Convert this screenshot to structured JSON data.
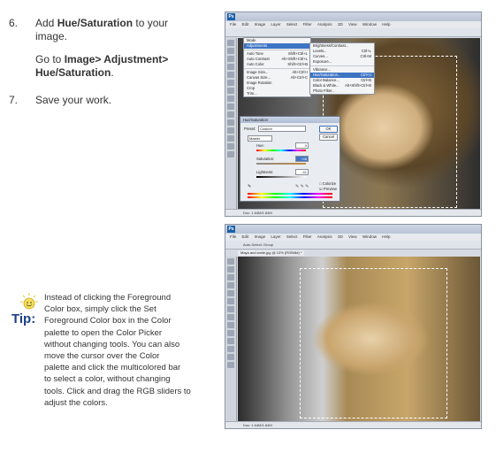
{
  "steps": [
    {
      "num": "6.",
      "pre": "Add ",
      "bold": "Hue/Saturation",
      "post": " to your image."
    },
    {
      "num": "",
      "pre": "Go to ",
      "bold": "Image> Adjustment> Hue/Saturation",
      "post": "."
    },
    {
      "num": "7.",
      "pre": "Save your work.",
      "bold": "",
      "post": ""
    }
  ],
  "tip": {
    "label": "Tip:",
    "lines": [
      "Instead of clicking the Foreground",
      "Color box, simply click the Set",
      "Foreground Color box in the Color",
      "palette to open the Color Picker",
      "without changing tools. You can also",
      "move the cursor over the Color",
      "palette and click  the multicolored bar",
      "to select a color, without changing",
      "tools. Click and drag the RGB sliders to",
      "adjust the colors."
    ]
  },
  "screenshot1": {
    "logo": "Ps",
    "menu_items": [
      "File",
      "Edit",
      "Image",
      "Layer",
      "Select",
      "Filter",
      "Analysis",
      "3D",
      "View",
      "Window",
      "Help"
    ],
    "image_menu": [
      "Mode",
      "Adjustments",
      "Auto Tone",
      "Auto Contrast",
      "Auto Color",
      "Image Size...",
      "Canvas Size...",
      "Image Rotation",
      "Crop",
      "Trim..."
    ],
    "image_menu_shortcuts": [
      "",
      "",
      "Shift+Ctrl+L",
      "Alt+Shift+Ctrl+L",
      "Shift+Ctrl+B",
      "Alt+Ctrl+I",
      "Alt+Ctrl+C",
      "",
      "",
      ""
    ],
    "adjust_menu": [
      "Brightness/Contrast...",
      "Levels...",
      "Curves...",
      "Exposure...",
      "Vibrance...",
      "Hue/Saturation...",
      "Color Balance...",
      "Black & White...",
      "Photo Filter..."
    ],
    "adjust_shortcuts": [
      "",
      "Ctrl+L",
      "Ctrl+M",
      "",
      "",
      "Ctrl+U",
      "Ctrl+B",
      "Alt+Shift+Ctrl+B",
      ""
    ],
    "dialog": {
      "title": "Hue/Saturation",
      "preset_label": "Preset:",
      "preset_value": "Custom",
      "ok": "OK",
      "cancel": "Cancel",
      "channel": "Master",
      "hue_label": "Hue:",
      "hue_value": "0",
      "sat_label": "Saturation:",
      "sat_value": "+48",
      "light_label": "Lightness:",
      "light_value": "-41",
      "colorize": "Colorize",
      "preview": "Preview"
    },
    "status": "Doc: 1.64M/1.64M"
  },
  "screenshot2": {
    "logo": "Ps",
    "menu_items": [
      "File",
      "Edit",
      "Image",
      "Layer",
      "Select",
      "Filter",
      "Analysis",
      "3D",
      "View",
      "Window",
      "Help"
    ],
    "options": "Auto-Select: Group",
    "tab": "Maya and smile.jpg @ 13% (RGB/8#) *",
    "status": "Doc: 1.64M/1.64M"
  }
}
